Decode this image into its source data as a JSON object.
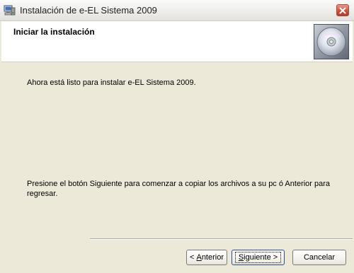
{
  "window": {
    "title": "Instalación de e-EL Sistema 2009",
    "icon": "installer-computer-icon",
    "close_icon": "close-icon"
  },
  "header": {
    "title": "Iniciar la instalación",
    "image": "cd-disc-icon"
  },
  "content": {
    "ready_text": "Ahora está listo para instalar e-EL Sistema 2009.",
    "instructions_text": "Presione el botón Siguiente para comenzar a copiar los archivos a su pc ó Anterior para regresar."
  },
  "buttons": {
    "back": {
      "prefix": "< ",
      "mnemonic": "A",
      "rest": "nterior"
    },
    "next": {
      "mnemonic": "S",
      "rest": "iguiente",
      "suffix": " >"
    },
    "cancel": "Cancelar"
  },
  "colors": {
    "dialog_bg": "#ECE9D8",
    "close_button": "#C8553F"
  }
}
